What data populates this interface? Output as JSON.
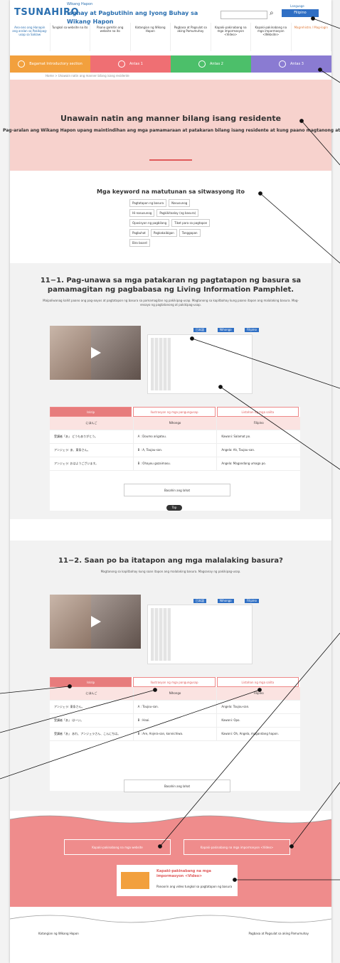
{
  "header": {
    "logo": "TSUNAHIRO",
    "tag_small": "Wikang Hapon",
    "tag_main": "Isgnay at Pagbutihin ang Iyong Buhay sa Wikang Hapon",
    "lang_label": "Language",
    "lang_button": "Filipino",
    "search_icon": "search-icon"
  },
  "nav": [
    "Ano-ano ang Hanapin ang aralan sa Pakikipag-usap sa Saklaw",
    "Tungkol sa website na ito",
    "Paano gamitin ang website na ito",
    "Katangian ng Wikang Hapon",
    "Pagbasa at Pagsulat sa aking Pamumuhay",
    "Kapaki-pakinabang na mga impormasyon <Video>",
    "Kapaki-pakinabang na mga impormasyon <Website>",
    "Magrehistro / Mag-login"
  ],
  "tabs": [
    {
      "label": "Bagamat Introductory section",
      "color": "#f2a03d"
    },
    {
      "label": "Antas 1",
      "color": "#ef6f73"
    },
    {
      "label": "Antas 2",
      "color": "#4cbf6a"
    },
    {
      "label": "Antas 3",
      "color": "#8a7bd2"
    }
  ],
  "crumb": "Home  >  Unawain natin ang manner bilang isang residente",
  "hero": {
    "title": "Unawain natin ang manner bilang isang residente",
    "subtitle": "Pag-aralan ang Wikang Hapon upang maintindihan ang mga pamamaraan at patakaran bilang isang residente at kung paano magtanong at humingi ng payo sa kapitbahay kung paano itapon ang basura at paano kumilos bilang isang residente."
  },
  "keywords": {
    "title": "Mga keyword na matutunan sa sitwasyong ito",
    "items": [
      "Pagtatapon ng basura",
      "Nasusunog",
      "Hi-nasusunog",
      "Pagkikitaalay (ng basura)",
      "Oposisyon ng pagbilang",
      "Tiket para sa pagtapon",
      "Pagbuhat",
      "Pagkakaibigan",
      "Tanggapan",
      "Biro board"
    ]
  },
  "section1": {
    "title_a": "11−1. Pag-unawa sa mga patakaran ng pagtatapon ng basura sa",
    "title_b": "pamamagitan ng pagbabasa ng Living Information Pamphlet.",
    "desc": "Maipaliwanag kahit paano ang pag-aayos at pagtatapon ng basura sa pamamagitan ng pakikipag-usap. Magtanong sa kapitbahay kung paano itapon ang malalaking basura. Mag-ensayo ng pagtatanong at pakikipag-usap.",
    "dl": [
      "日本語",
      "Nihongo",
      "Filipino"
    ],
    "tabs": [
      "Iskrip",
      "Ilustrasyon ng mga pangungusap",
      "Listahan ng mga salita"
    ],
    "head": [
      "にほんご",
      "Nihongo",
      "Filipino"
    ],
    "rows": [
      [
        "受講者「あ」 どうもありがとう。",
        "A : Doumo arigatou.",
        "Kawani: Salamat po."
      ],
      [
        "アンジェラ: あ、東条さん。",
        "B : A, Toujou-san.",
        "Angela: Ah, Toujou-san."
      ],
      [
        "アンジェラ: おはようございます。",
        "B : Ohayou gozaimasu.",
        "Angela: Magandang umaga po."
      ]
    ],
    "more": "Basahin ang lahat",
    "pill": "Top"
  },
  "section2": {
    "title": "11−2. Saan po ba itatapon ang mga malalaking basura?",
    "desc": "Magtanong sa kapitbahay kung saan itapon ang malalaking basura. Magsanay ng pakikipag-usap.",
    "dl": [
      "日本語",
      "Nihongo",
      "Filipino"
    ],
    "tabs": [
      "Iskrip",
      "Ilustrasyon ng mga pangungusap",
      "Listahan ng mga salita"
    ],
    "head": [
      "にほんご",
      "Nihongo",
      "Filipino"
    ],
    "rows": [
      [
        "アンジェラ: 東条さん。",
        "A : Toujou-san.",
        "Angela: Toujou-san."
      ],
      [
        "受講者「あ」 はーい。",
        "B : Haai.",
        "Kawani: Opo."
      ],
      [
        "受講者「あ」 あれ、アンジェラさん、こんにちは。",
        "B : Are, Anjera-san, konnichiwa.",
        "Kawani: Oh, Angela, magandang hapon."
      ]
    ],
    "more": "Basahin ang lahat"
  },
  "pink": {
    "btn1": "Kapaki-pakinabang na mga website",
    "btn2": "Kapaki-pakinabang na mga impormasyon <Video>",
    "card_title": "Kapaki-pakinabang na mga impormasyon <Video>",
    "card_sub": "Panoorin ang video tungkol sa pagtatapon ng basura"
  },
  "footer": {
    "left": "Katangian ng Wikang Hapon",
    "right": "Pagbasa at Pagsulat sa aking Pamumuhay"
  },
  "colors": {
    "accent": "#2f6fc4",
    "pink": "#ef8c8c",
    "hero": "#f7d2cd"
  }
}
